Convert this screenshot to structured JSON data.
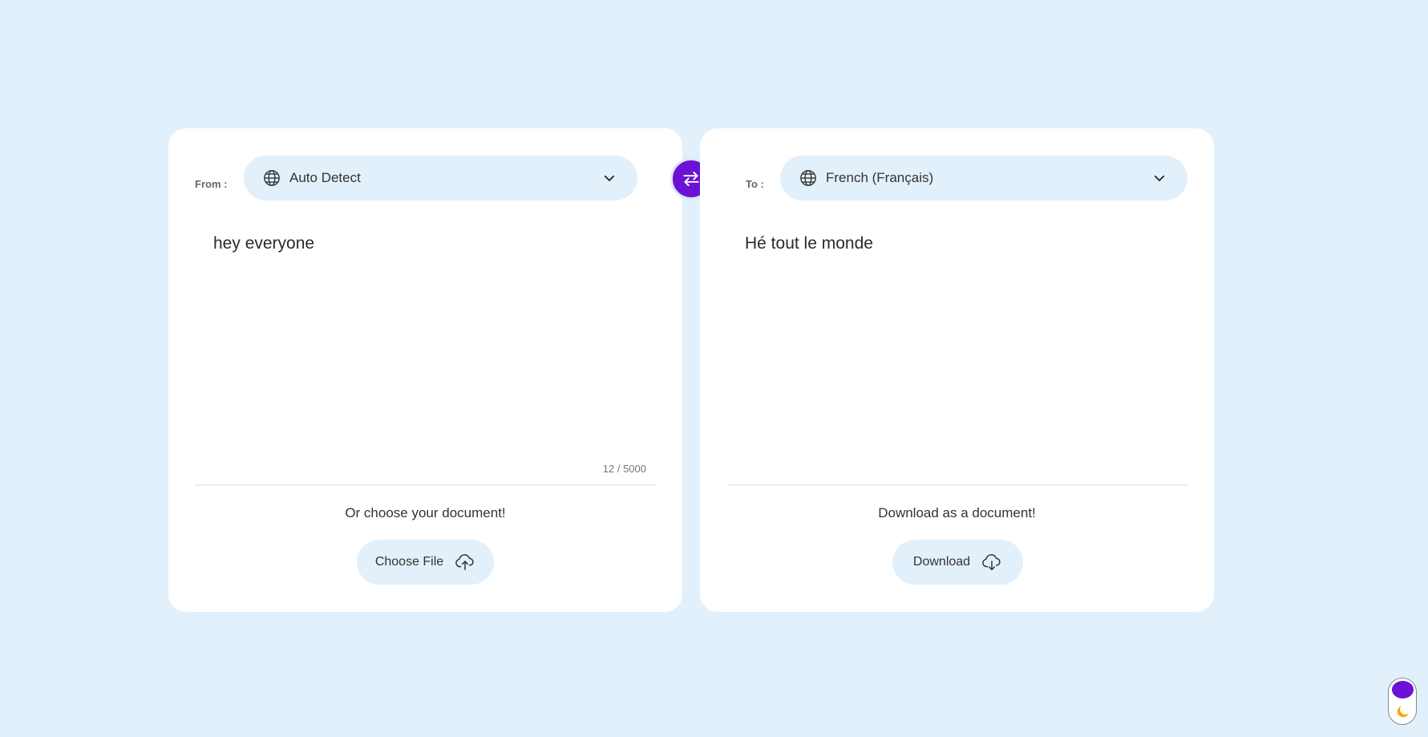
{
  "source": {
    "label": "From :",
    "language": "Auto Detect",
    "text": "hey everyone",
    "char_count": "12 / 5000",
    "doc_caption": "Or choose your document!",
    "doc_button": "Choose File"
  },
  "target": {
    "label": "To :",
    "language": "French (Français)",
    "text": "Hé tout le monde",
    "doc_caption": "Download as a document!",
    "doc_button": "Download"
  },
  "icons": {
    "globe": "globe-icon",
    "chevron": "chevron-down-icon",
    "swap": "swap-arrows-icon",
    "upload": "cloud-upload-icon",
    "download": "cloud-download-icon",
    "theme": "moon-icon"
  },
  "colors": {
    "background": "#e2f0fc",
    "card": "#ffffff",
    "accent": "#6c11d6",
    "moon": "#f5a900"
  },
  "theme": {
    "mode": "light"
  }
}
